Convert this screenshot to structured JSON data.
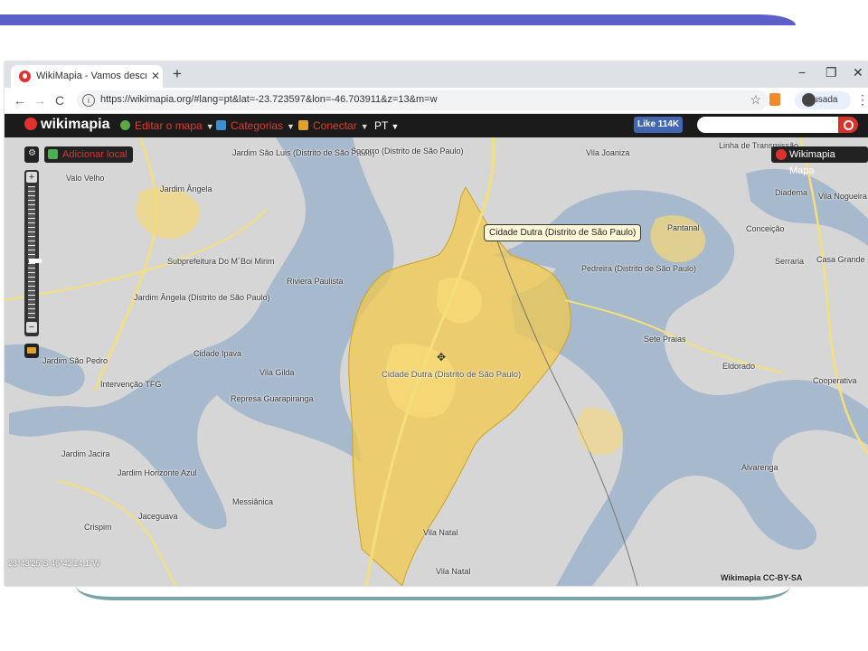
{
  "browser": {
    "tab_title": "WikiMapia - Vamos descrever o",
    "tab_close": "✕",
    "new_tab": "+",
    "win_minimize": "−",
    "win_restore": "❐",
    "win_close": "✕",
    "nav_back": "←",
    "nav_forward": "→",
    "nav_reload": "C",
    "url": "https://wikimapia.org/#lang=pt&lat=-23.723597&lon=-46.703911&z=13&m=w",
    "profile_status": "Pausada",
    "menu": "⋮"
  },
  "wikimapia_bar": {
    "logo": "wikimapia",
    "edit_map": "Editar o mapa",
    "categories": "Categorias",
    "connect": "Conectar",
    "lang": "PT",
    "like": "Like 114K",
    "search_placeholder": ""
  },
  "map": {
    "add_place": "Adicionar local",
    "map_type": "Wikimapia Mapa",
    "tooltip": "Cidade Dutra (Distrito de São Paulo)",
    "coords": "23°43'25\"S 46°42'14.1\"W",
    "license": "Wikimapia CC-BY-SA",
    "labels": [
      {
        "text": "Linha de Transmissão"
      },
      {
        "text": "Jardim São Luis (Distrito de São Paulo)"
      },
      {
        "text": "Socorro (Distrito de São Paulo)"
      },
      {
        "text": "Vila Joaniza"
      },
      {
        "text": "Valo Velho"
      },
      {
        "text": "Jardim Ângela"
      },
      {
        "text": "Diadema"
      },
      {
        "text": "Vila Nogueira"
      },
      {
        "text": "Pantanal"
      },
      {
        "text": "Conceição"
      },
      {
        "text": "Subprefeitura Do M´Boi Mirim"
      },
      {
        "text": "Riviera Paulista"
      },
      {
        "text": "Pedreira (Distrito de São Paulo)"
      },
      {
        "text": "Serraria"
      },
      {
        "text": "Casa Grande"
      },
      {
        "text": "Jardim Ângela (Distrito de São Paulo)"
      },
      {
        "text": "Sete Praias"
      },
      {
        "text": "Cidade Ipava"
      },
      {
        "text": "Jardim São Pedro"
      },
      {
        "text": "Vila Gilda"
      },
      {
        "text": "Eldorado"
      },
      {
        "text": "Intervenção TFG"
      },
      {
        "text": "Cidade Dutra (Distrito de São Paulo)"
      },
      {
        "text": "Cooperativa"
      },
      {
        "text": "Represa Guarapiranga"
      },
      {
        "text": "Jardim Jacira"
      },
      {
        "text": "Alvarenga"
      },
      {
        "text": "Jardim Horizonte Azul"
      },
      {
        "text": "Messiânica"
      },
      {
        "text": "Jaceguava"
      },
      {
        "text": "Crispim"
      },
      {
        "text": "Vila Natal"
      },
      {
        "text": "Vila Natal"
      }
    ]
  },
  "colors": {
    "water": "#a7b9cd",
    "land": "#d6d6d6",
    "highlight": "#f2c94c",
    "brand": "#e0312e"
  }
}
